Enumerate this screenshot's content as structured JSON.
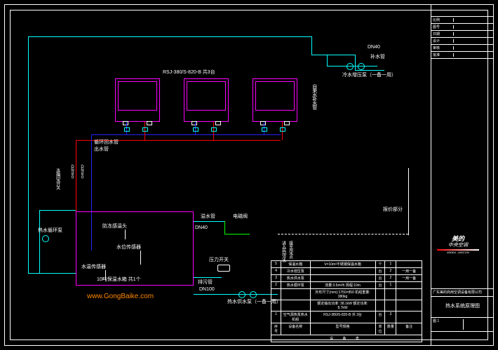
{
  "domain": "Diagram",
  "watermark": "www.GongBaike.com",
  "units_header": "RSJ-380/S-820-B  共3台",
  "logo": {
    "line1": "美的",
    "line2": "中央空调",
    "line3": "MIDEA - AIRCON"
  },
  "labels": {
    "cold_makeup_dn": "DN40",
    "bushui": "补水管",
    "cold_pump": "冷水增压泵（一备一用）",
    "zilai": "自来水补水管",
    "huishui": "循环回水管",
    "chushui": "出水管",
    "shuixiang_huishui": "水箱回水开关",
    "dn80a": "DN80",
    "dn80b": "DN80",
    "reshui_xunhuan": "热水循环泵",
    "fangdong": "防冻感温头",
    "shuiwei": "水位传感器",
    "shuiwen": "水温传感器",
    "yishui": "溢水管",
    "dianci": "电磁阀",
    "dn40b": "DN40",
    "yali": "压力开关",
    "paiwu": "排污管",
    "dn100": "DN100",
    "reshui_gongshui": "热水供水泵（一备一用）",
    "tank_title": "10吨保温水箱  共1个",
    "lou": "接至用水点",
    "baojia": "报价部分",
    "jinru": "进入房间冷水"
  },
  "parts": {
    "header": "设 备 表",
    "rows": [
      {
        "num": "5",
        "name": "保温水箱",
        "spec": "V=10m³不锈钢保温水箱",
        "unit": "个",
        "qty": "1",
        "remark": ""
      },
      {
        "num": "4",
        "name": "冷水增压泵",
        "spec": "",
        "unit": "台",
        "qty": "2",
        "remark": "一用一备"
      },
      {
        "num": "3",
        "name": "热水供水泵",
        "spec": "",
        "unit": "台",
        "qty": "2",
        "remark": "一用一备"
      },
      {
        "num": "2",
        "name": "热水循环泵",
        "spec": "流量:3.5m³/h 扬程:10m",
        "unit": "台",
        "qty": "1",
        "remark": ""
      },
      {
        "num": "",
        "name": "",
        "spec": "外形尺寸(mm):1750×850  机组重量: 380kg",
        "unit": "",
        "qty": "",
        "remark": ""
      },
      {
        "num": "",
        "name": "",
        "spec": "额定输出功率: 38.1kW  额定功率: 8.7kW",
        "unit": "",
        "qty": "",
        "remark": ""
      },
      {
        "num": "1",
        "name": "空气源热泵热水机组",
        "spec": "RSJ-380/S-820-B  共 3台",
        "unit": "台",
        "qty": "3",
        "remark": ""
      },
      {
        "num": "序号",
        "name": "设备名称",
        "spec": "型号规格",
        "unit": "单位",
        "qty": "数量",
        "remark": "备注"
      }
    ]
  },
  "titleblock": {
    "rows": [
      [
        "比例",
        ""
      ],
      [
        "图号",
        ""
      ],
      [
        "日期",
        ""
      ],
      [
        "设计",
        ""
      ],
      [
        "审核",
        ""
      ],
      [
        "批准",
        ""
      ]
    ],
    "project": "广东美的商用空调设备有限公司",
    "sheet": "热水系统原理图",
    "drawing_no": "图 1"
  }
}
